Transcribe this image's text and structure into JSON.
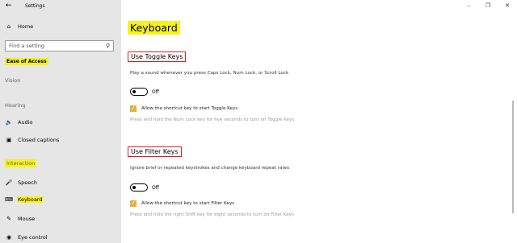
{
  "window": {
    "title": "Settings",
    "minimize": "–",
    "maximize": "❐",
    "close": "✕"
  },
  "sidebar": {
    "home": "Home",
    "search_placeholder": "Find a setting",
    "category": "Ease of Access",
    "vision": "Vision",
    "hearing": "Hearing",
    "audio": "Audio",
    "closed_captions": "Closed captions",
    "interaction": "Interaction",
    "speech": "Speech",
    "keyboard": "Keyboard",
    "mouse": "Mouse",
    "eye_control": "Eye control"
  },
  "main": {
    "title": "Keyboard",
    "toggle_keys": {
      "heading": "Use Toggle Keys",
      "description": "Play a sound whenever you press Caps Lock, Num Lock, or Scroll Lock",
      "toggle_state": "Off",
      "checkbox_label": "Allow the shortcut key to start Toggle Keys",
      "hint": "Press and hold the Num Lock key for five seconds to turn on Toggle Keys"
    },
    "filter_keys": {
      "heading": "Use Filter Keys",
      "description": "Ignore brief or repeated keystrokes and change keyboard repeat rates",
      "toggle_state": "Off",
      "checkbox_label": "Allow the shortcut key to start Filter Keys",
      "hint": "Press and hold the right Shift key for eight seconds to turn on Filter Keys"
    }
  }
}
